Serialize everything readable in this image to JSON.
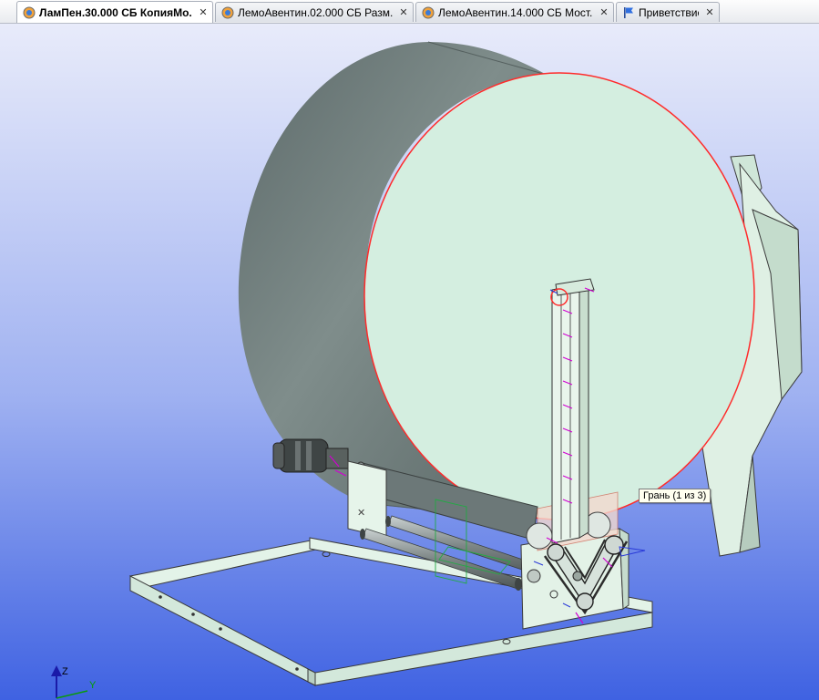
{
  "tabs": [
    {
      "label": "ЛамПен.30.000 СБ КопияМо...",
      "active": true,
      "icon": "model-icon"
    },
    {
      "label": "ЛемоАвентин.02.000 СБ Разм...",
      "active": false,
      "icon": "model-icon"
    },
    {
      "label": "ЛемоАвентин.14.000 СБ Мост...",
      "active": false,
      "icon": "model-icon"
    },
    {
      "label": "Приветствие",
      "active": false,
      "icon": "flag-icon"
    }
  ],
  "close_glyph": "✕",
  "tooltip": "Грань (1 из 3)",
  "axes": {
    "z_label": "Z",
    "y_label": "Y"
  },
  "colors": {
    "background_top": "#e6e9f9",
    "background_bottom": "#3a5ee0",
    "drum_body": "#6e7c7a",
    "drum_face": "#d4eee0",
    "selection": "#ff2020",
    "frame": "#d8eedd"
  }
}
